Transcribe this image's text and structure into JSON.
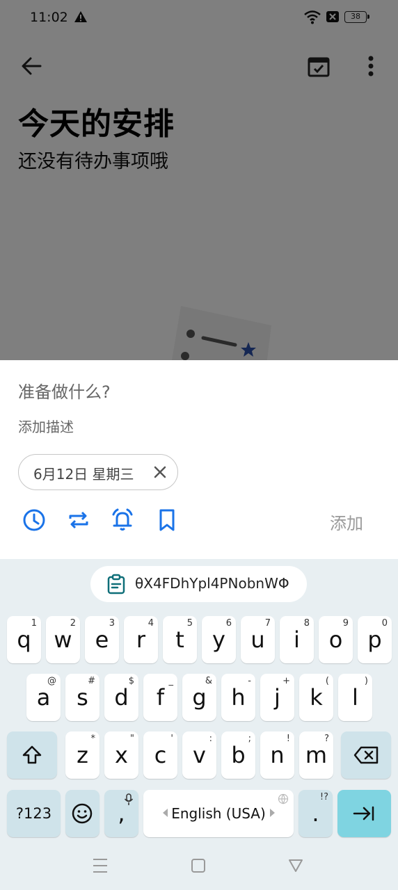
{
  "status_bar": {
    "time": "11:02",
    "battery": "38"
  },
  "header": {
    "title": "今天的安排",
    "subtitle": "还没有待办事项哦"
  },
  "sheet": {
    "task_placeholder": "准备做什么?",
    "description_placeholder": "添加描述",
    "date_chip": "6月12日 星期三",
    "add_label": "添加",
    "accent_color": "#1a73e8",
    "tools": [
      "clock-icon",
      "repeat-icon",
      "alarm-icon",
      "bookmark-icon"
    ]
  },
  "keyboard": {
    "clipboard_text": "θX4FDhYpl4PNobnWΦ",
    "row1": [
      {
        "k": "q",
        "h": "1"
      },
      {
        "k": "w",
        "h": "2"
      },
      {
        "k": "e",
        "h": "3"
      },
      {
        "k": "r",
        "h": "4"
      },
      {
        "k": "t",
        "h": "5"
      },
      {
        "k": "y",
        "h": "6"
      },
      {
        "k": "u",
        "h": "7"
      },
      {
        "k": "i",
        "h": "8"
      },
      {
        "k": "o",
        "h": "9"
      },
      {
        "k": "p",
        "h": "0"
      }
    ],
    "row2": [
      {
        "k": "a",
        "h": "@"
      },
      {
        "k": "s",
        "h": "#"
      },
      {
        "k": "d",
        "h": "$"
      },
      {
        "k": "f",
        "h": "_"
      },
      {
        "k": "g",
        "h": "&"
      },
      {
        "k": "h",
        "h": "-"
      },
      {
        "k": "j",
        "h": "+"
      },
      {
        "k": "k",
        "h": "("
      },
      {
        "k": "l",
        "h": ")"
      }
    ],
    "row3": [
      {
        "k": "z",
        "h": "*"
      },
      {
        "k": "x",
        "h": "\""
      },
      {
        "k": "c",
        "h": "'"
      },
      {
        "k": "v",
        "h": ":"
      },
      {
        "k": "b",
        "h": ";"
      },
      {
        "k": "n",
        "h": "!"
      },
      {
        "k": "m",
        "h": "?"
      }
    ],
    "symbols_label": "?123",
    "comma": ",",
    "space_label": "English (USA)",
    "period": ".",
    "period_hint": "!?"
  }
}
